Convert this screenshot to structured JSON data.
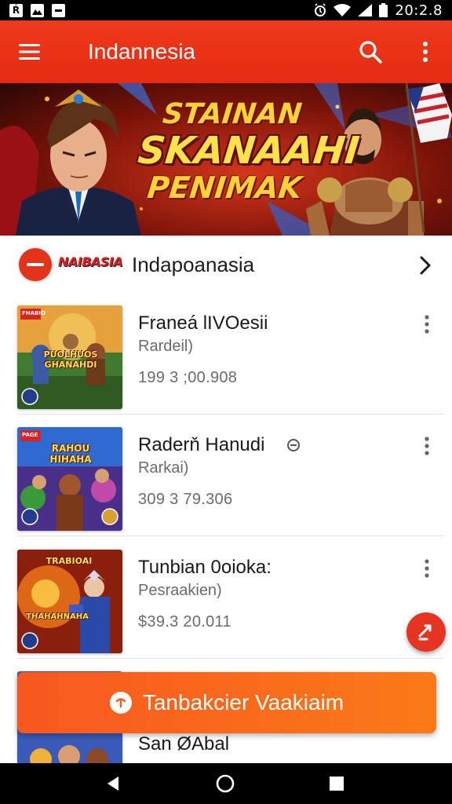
{
  "status_bar": {
    "left_icons": [
      "notification-app-icon-1",
      "notification-photo-icon",
      "notification-app-icon-2"
    ],
    "right_icons": [
      "alarm-icon",
      "wifi-icon",
      "signal-icon",
      "battery-icon"
    ],
    "time": "20:2.8"
  },
  "app_bar": {
    "title": "Indannesia",
    "menu_icon": "hamburger-menu-icon",
    "search_icon": "search-icon",
    "more_icon": "more-vertical-icon",
    "color": "#e8321a"
  },
  "banner": {
    "line1": "STAINAN",
    "line2": "SKANAAHI",
    "line3": "PENIMAK"
  },
  "filter": {
    "logo": "NAIBASIA",
    "label": "Indapoanasia",
    "chevron_icon": "chevron-right-icon"
  },
  "items": [
    {
      "title": "Franeá lIVOesii",
      "subtitle": "Rardeil)",
      "price": "199 3 ;00.908",
      "thumb_label": "FHABIO",
      "thumb_title": "PUOLHUOS\nGHANAHDI",
      "show_minus": false
    },
    {
      "title": "Raderň Hanudi",
      "subtitle": "Rarkai)",
      "price": "309 3 79.306",
      "thumb_label": "PAGE",
      "thumb_title": "RAHOU\nHIHAHA",
      "show_minus": true
    },
    {
      "title": "Tunbian 0oioka:",
      "subtitle": "Pesraakien)",
      "price": "$39.3  20.011",
      "thumb_label": "TRABIOAI",
      "thumb_title": "THAHAHNAHA",
      "show_minus": false
    },
    {
      "title": "San ØAbal",
      "subtitle": "",
      "price": ""
    }
  ],
  "cta": {
    "label": "Tanbakcier Vaakiaim",
    "icon": "arrow-circle-icon"
  },
  "fab": {
    "icon": "edit-fab-icon"
  },
  "nav": {
    "back": "back-icon",
    "home": "home-icon",
    "recents": "recents-icon"
  }
}
